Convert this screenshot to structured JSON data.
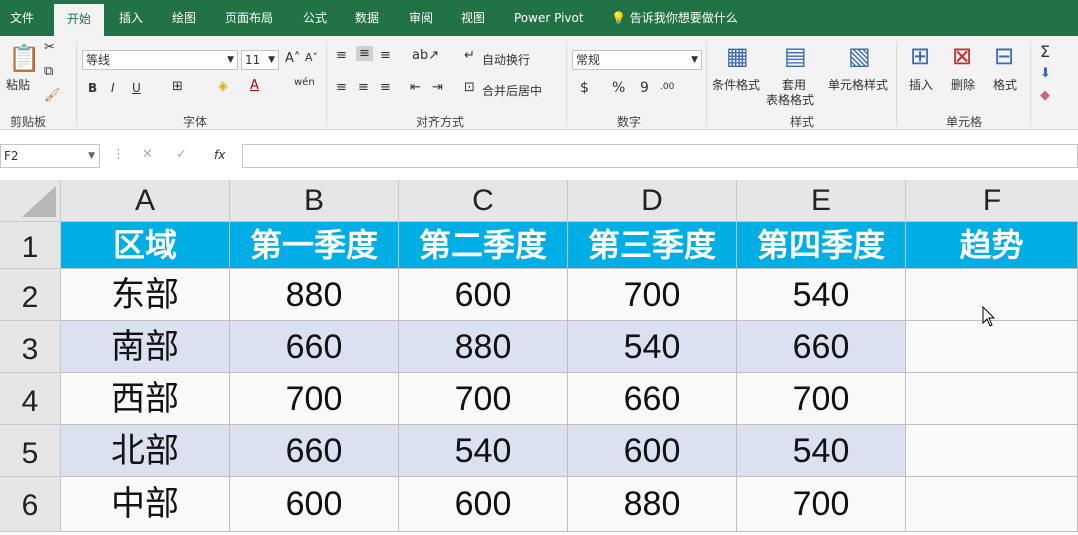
{
  "ribbon_tabs": [
    "文件",
    "开始",
    "插入",
    "绘图",
    "页面布局",
    "公式",
    "数据",
    "审阅",
    "视图",
    "Power Pivot",
    "告诉我你想要做什么"
  ],
  "clipboard": {
    "paste": "粘贴",
    "group": "剪贴板"
  },
  "font": {
    "name": "等线",
    "size": "11",
    "bold": "B",
    "italic": "I",
    "underline": "U",
    "phonetic": "wén",
    "group": "字体"
  },
  "alignment": {
    "wrap": "自动换行",
    "merge": "合并后居中",
    "group": "对齐方式"
  },
  "number": {
    "format": "常规",
    "currency": "$",
    "percent": "%",
    "comma": "9",
    "dec_inc": ".00",
    "group": "数字"
  },
  "styles": {
    "conditional": "条件格式",
    "table_format_1": "套用",
    "table_format_2": "表格格式",
    "cell_styles": "单元格样式",
    "group": "样式"
  },
  "cells": {
    "insert": "插入",
    "delete": "删除",
    "format": "格式",
    "group": "单元格"
  },
  "formula_bar": {
    "name_box": "F2",
    "fx": "fx",
    "value": ""
  },
  "columns": [
    "A",
    "B",
    "C",
    "D",
    "E",
    "F"
  ],
  "rows": [
    "1",
    "2",
    "3",
    "4",
    "5",
    "6"
  ],
  "table": {
    "header": [
      "区域",
      "第一季度",
      "第二季度",
      "第三季度",
      "第四季度",
      "趋势"
    ],
    "body": [
      [
        "东部",
        "880",
        "600",
        "700",
        "540",
        ""
      ],
      [
        "南部",
        "660",
        "880",
        "540",
        "660",
        ""
      ],
      [
        "西部",
        "700",
        "700",
        "660",
        "700",
        ""
      ],
      [
        "北部",
        "660",
        "540",
        "600",
        "540",
        ""
      ],
      [
        "中部",
        "600",
        "600",
        "880",
        "700",
        ""
      ]
    ]
  },
  "colors": {
    "ribbon_green": "#217346",
    "header_fill": "#00aee6",
    "band_fill": "#dce1f2"
  }
}
